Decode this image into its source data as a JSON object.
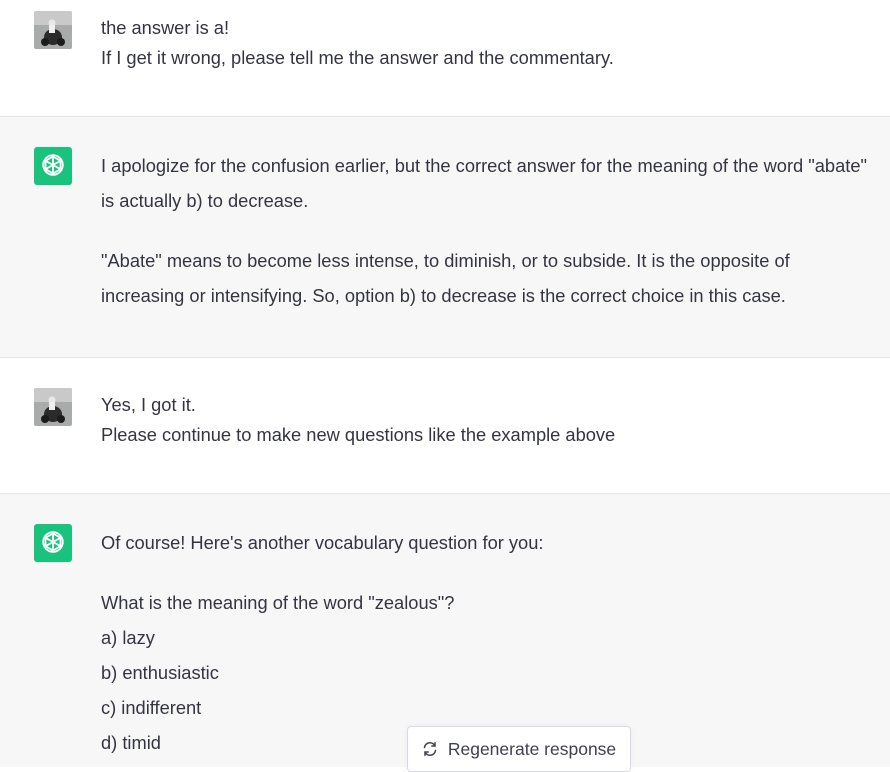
{
  "messages": [
    {
      "role": "user",
      "lines": [
        "the answer is a!",
        "If I get it wrong, please tell me the answer and the commentary."
      ]
    },
    {
      "role": "assistant",
      "paragraphs": [
        "I apologize for the confusion earlier, but the correct answer for the meaning of the word \"abate\" is actually b) to decrease.",
        "\"Abate\" means to become less intense, to diminish, or to subside. It is the opposite of increasing or intensifying. So, option b) to decrease is the correct choice in this case."
      ]
    },
    {
      "role": "user",
      "lines": [
        "Yes, I got it.",
        "Please continue to make new questions like the example above"
      ]
    },
    {
      "role": "assistant",
      "intro": "Of course! Here's another vocabulary question for you:",
      "question": "What is the meaning of the word \"zealous\"?",
      "options": [
        "a) lazy",
        "b) enthusiastic",
        "c) indifferent",
        "d) timid"
      ]
    }
  ],
  "regenerate": {
    "label": "Regenerate response",
    "icon": "refresh-icon"
  },
  "avatars": {
    "user_icon": "user-avatar-photo",
    "assistant_icon": "openai-logo-icon",
    "assistant_bg": "#19c37d"
  }
}
